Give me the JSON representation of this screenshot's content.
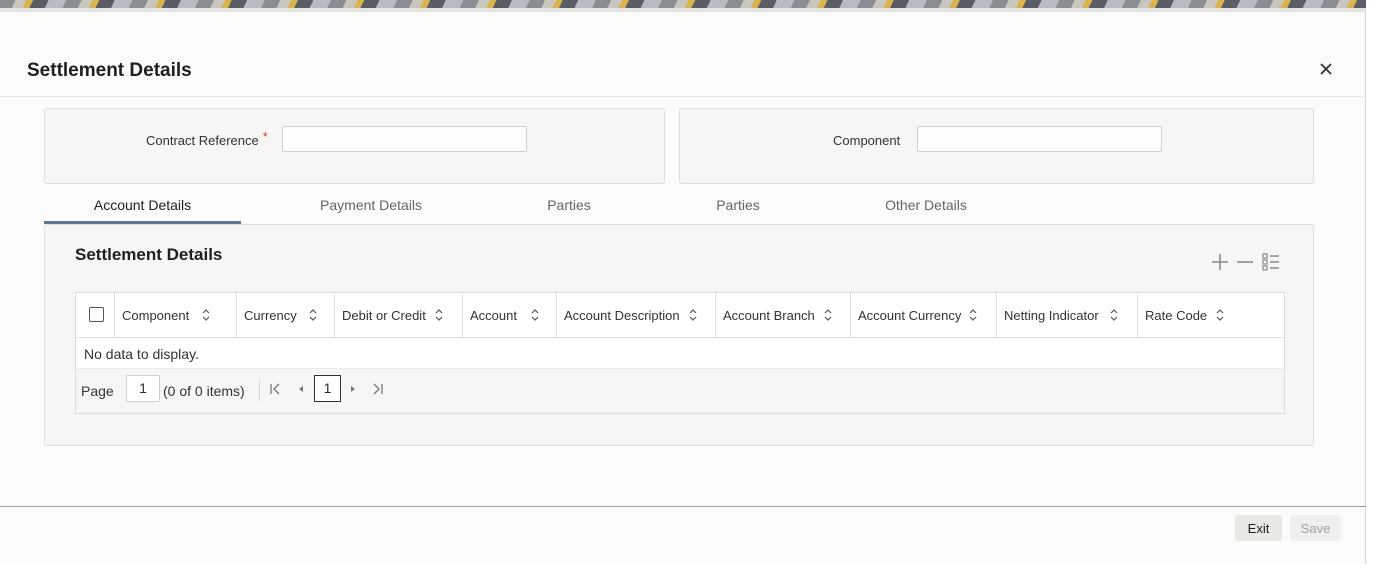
{
  "dialog": {
    "title": "Settlement Details",
    "close_icon": "close-icon"
  },
  "header_fields": {
    "contract_reference": {
      "label": "Contract Reference",
      "required_mark": "*",
      "value": ""
    },
    "component": {
      "label": "Component",
      "value": ""
    }
  },
  "tabs": [
    {
      "label": "Account Details",
      "active": true
    },
    {
      "label": "Payment Details",
      "active": false
    },
    {
      "label": "Parties",
      "active": false
    },
    {
      "label": "Parties",
      "active": false
    },
    {
      "label": "Other Details",
      "active": false
    }
  ],
  "section": {
    "title": "Settlement Details",
    "toolbar_icons": [
      "add-icon",
      "remove-icon",
      "column-list-icon"
    ]
  },
  "grid": {
    "columns": [
      "Component",
      "Currency",
      "Debit or Credit",
      "Account",
      "Account Description",
      "Account Branch",
      "Account Currency",
      "Netting Indicator",
      "Rate Code"
    ],
    "empty_message": "No data to display."
  },
  "pagination": {
    "page_label": "Page",
    "page_value": "1",
    "items_text": "(0 of 0 items)",
    "current_page": "1"
  },
  "footer": {
    "exit_label": "Exit",
    "save_label": "Save"
  },
  "colors": {
    "accent": "#5c7694",
    "required": "#c74634"
  }
}
